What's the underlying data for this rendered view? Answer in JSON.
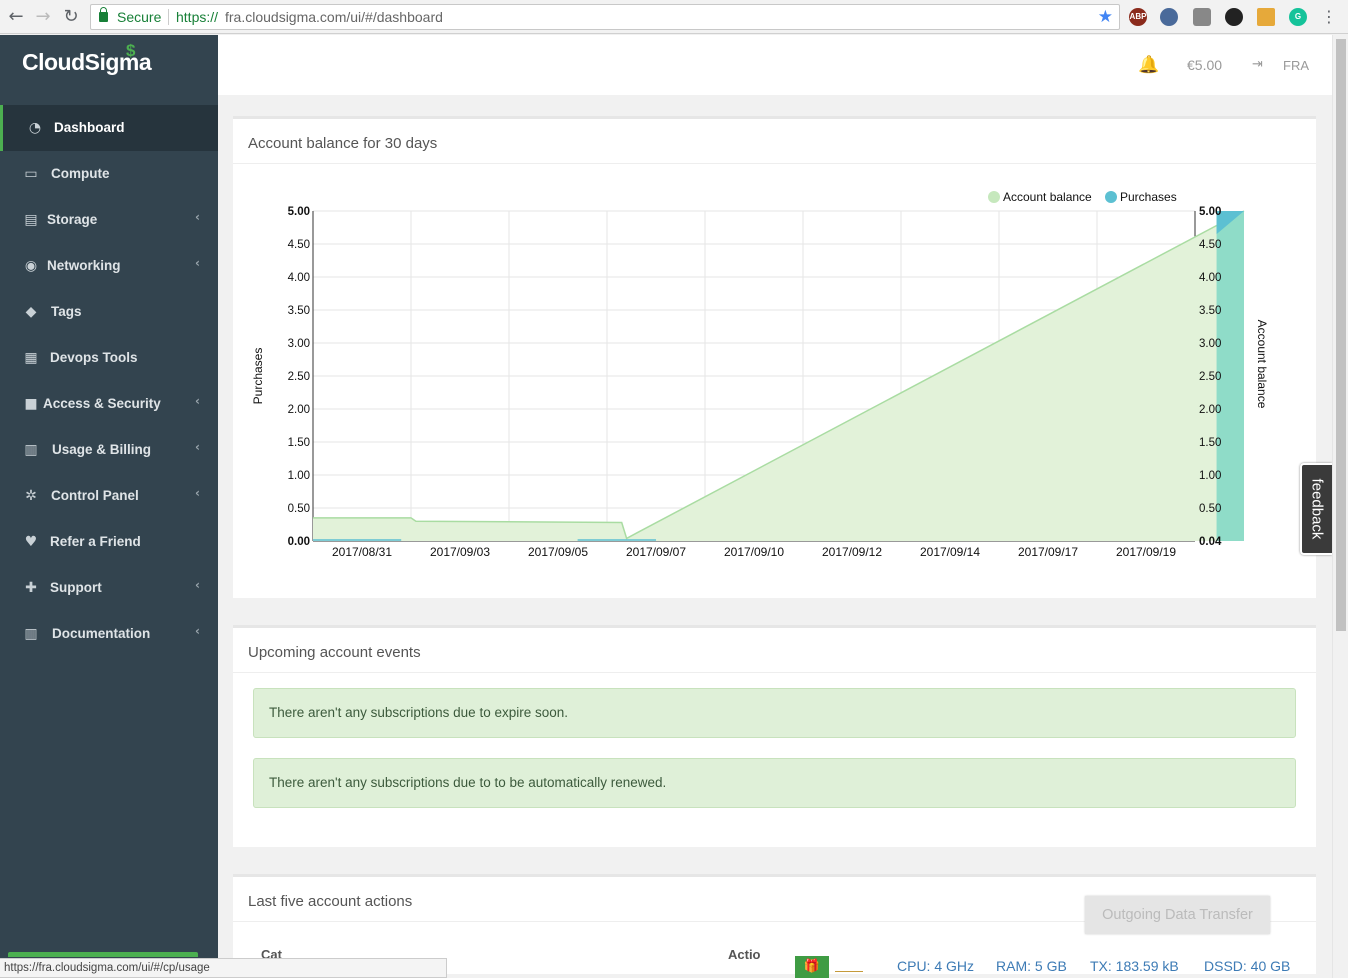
{
  "browser": {
    "secure_label": "Secure",
    "url_scheme": "https://",
    "url_rest": "fra.cloudsigma.com/ui/#/dashboard",
    "status_url": "https://fra.cloudsigma.com/ui/#/cp/usage"
  },
  "sidebar": {
    "logo": "CloudSigma",
    "items": [
      {
        "label": "Dashboard",
        "icon": "dashboard-icon",
        "glyph": "◔"
      },
      {
        "label": "Compute",
        "icon": "monitor-icon",
        "glyph": "▭"
      },
      {
        "label": "Storage",
        "icon": "hdd-icon",
        "glyph": "▤"
      },
      {
        "label": "Networking",
        "icon": "globe-icon",
        "glyph": "◉"
      },
      {
        "label": "Tags",
        "icon": "tags-icon",
        "glyph": "◆"
      },
      {
        "label": "Devops Tools",
        "icon": "list-icon",
        "glyph": "▦"
      },
      {
        "label": "Access & Security",
        "icon": "lock-icon",
        "glyph": "■"
      },
      {
        "label": "Usage & Billing",
        "icon": "bar-chart-icon",
        "glyph": "▥"
      },
      {
        "label": "Control Panel",
        "icon": "cogs-icon",
        "glyph": "✲"
      },
      {
        "label": "Refer a Friend",
        "icon": "heart-icon",
        "glyph": "♥"
      },
      {
        "label": "Support",
        "icon": "medkit-icon",
        "glyph": "✚"
      },
      {
        "label": "Documentation",
        "icon": "bank-icon",
        "glyph": "▥"
      }
    ]
  },
  "topbar": {
    "balance": "€5.00",
    "region": "FRA"
  },
  "panels": {
    "balance_title": "Account balance for 30 days",
    "events_title": "Upcoming account events",
    "events": [
      "There aren't any subscriptions due to expire soon.",
      "There aren't any subscriptions due to to be automatically renewed."
    ],
    "actions_title": "Last five account actions",
    "actions_columns": [
      "Cat",
      "Actio"
    ]
  },
  "feedback_label": "feedback",
  "outgoing_label": "Outgoing Data Transfer",
  "usage": {
    "cpu": "CPU: 4 GHz",
    "ram": "RAM: 5 GB",
    "tx": "TX: 183.59 kB",
    "dssd": "DSSD: 40 GB"
  },
  "colors": {
    "balance_fill": "#e2f2d9",
    "balance_line": "#a9dca2",
    "purchases_fill": "#8fdcc8",
    "purchases_top": "#5cc0d2"
  },
  "chart_data": {
    "type": "area",
    "title": "Account balance for 30 days",
    "categories": [
      "2017/08/31",
      "2017/09/03",
      "2017/09/05",
      "2017/09/07",
      "2017/09/10",
      "2017/09/12",
      "2017/09/14",
      "2017/09/17",
      "2017/09/19"
    ],
    "left_axis_label": "Purchases",
    "right_axis_label": "Account balance",
    "left_ticks": [
      "5.00",
      "4.50",
      "4.00",
      "3.50",
      "3.00",
      "2.50",
      "2.00",
      "1.50",
      "1.00",
      "0.50",
      "0.00"
    ],
    "right_ticks": [
      "5.00",
      "4.50",
      "4.00",
      "3.50",
      "3.00",
      "2.50",
      "2.00",
      "1.50",
      "1.00",
      "0.50",
      "0.04"
    ],
    "ylim": [
      0,
      5
    ],
    "legend_position": "top-right",
    "series": [
      {
        "name": "Account balance",
        "x": [
          0,
          0.5,
          0.55,
          2.65,
          2.7,
          9.0
        ],
        "values": [
          0.35,
          0.35,
          0.3,
          0.28,
          0.04,
          5.0
        ]
      },
      {
        "name": "Purchases",
        "bars": [
          {
            "x_start": 8.72,
            "x_end": 9.0,
            "value": 5.0
          }
        ]
      }
    ]
  }
}
